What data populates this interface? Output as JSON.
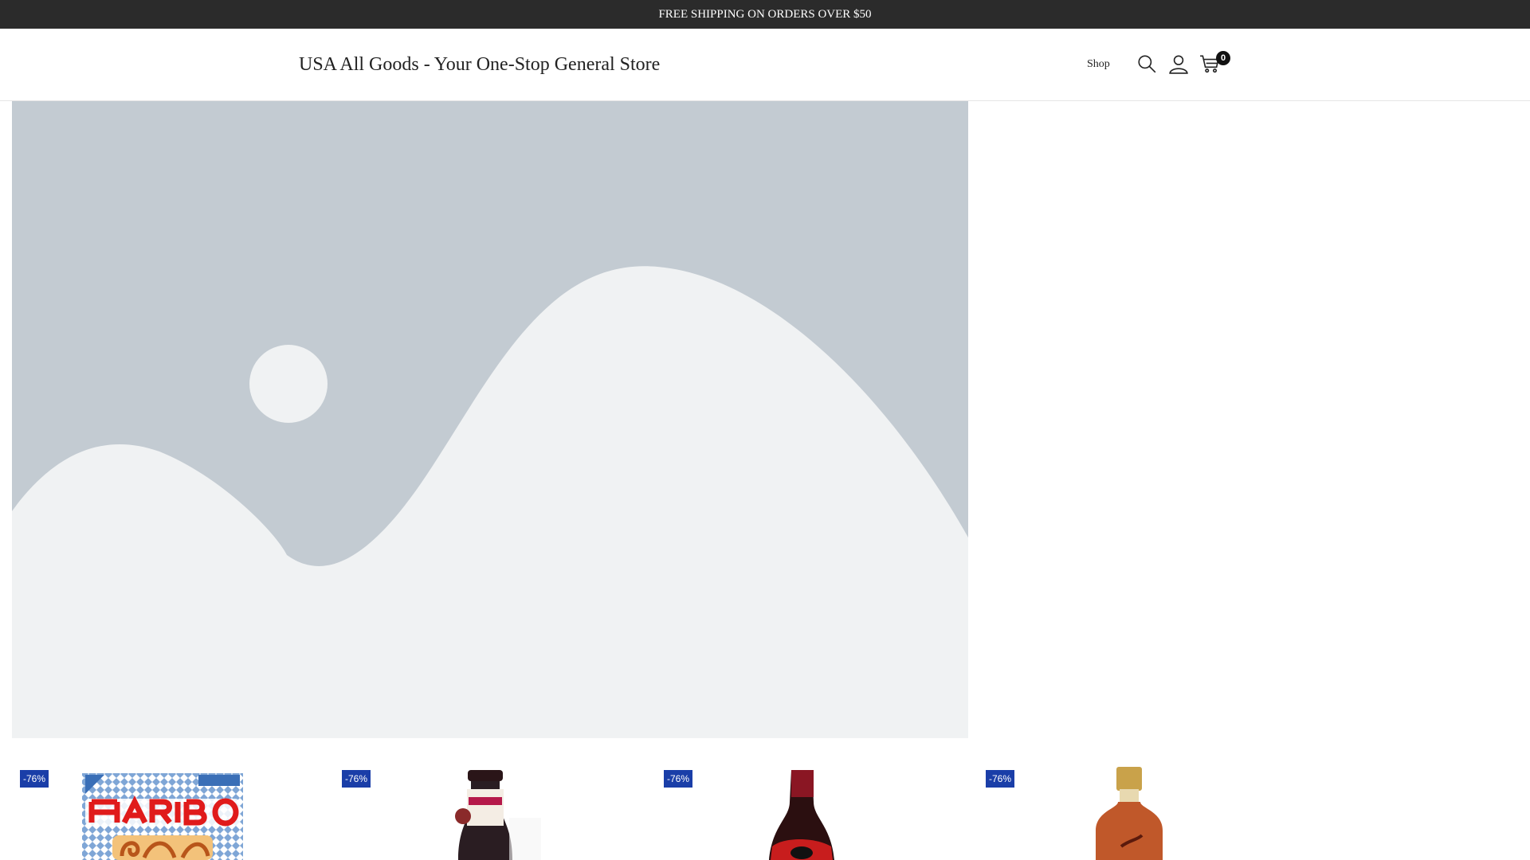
{
  "announcement": {
    "text": "FREE SHIPPING ON ORDERS OVER $50"
  },
  "header": {
    "site_title": "USA All Goods - Your One-Stop General Store",
    "nav": [
      {
        "label": "Shop"
      }
    ],
    "icons": [
      "search-icon",
      "account-icon",
      "cart-icon"
    ],
    "cart_count": "0"
  },
  "hero": {
    "image": "placeholder-landscape"
  },
  "products": [
    {
      "badge": "-76%",
      "image": "haribo-brezeln-bag"
    },
    {
      "badge": "-76%",
      "image": "dark-wine-bottle"
    },
    {
      "badge": "-76%",
      "image": "liqueur-bottle"
    },
    {
      "badge": "-76%",
      "image": "amber-spirit-bottle"
    }
  ],
  "colors": {
    "announcement_bg": "#2b2b2b",
    "badge_bg": "#1a3ea8",
    "hero_bg": "#c3cbd2",
    "hero_shape": "#f0f2f3"
  }
}
